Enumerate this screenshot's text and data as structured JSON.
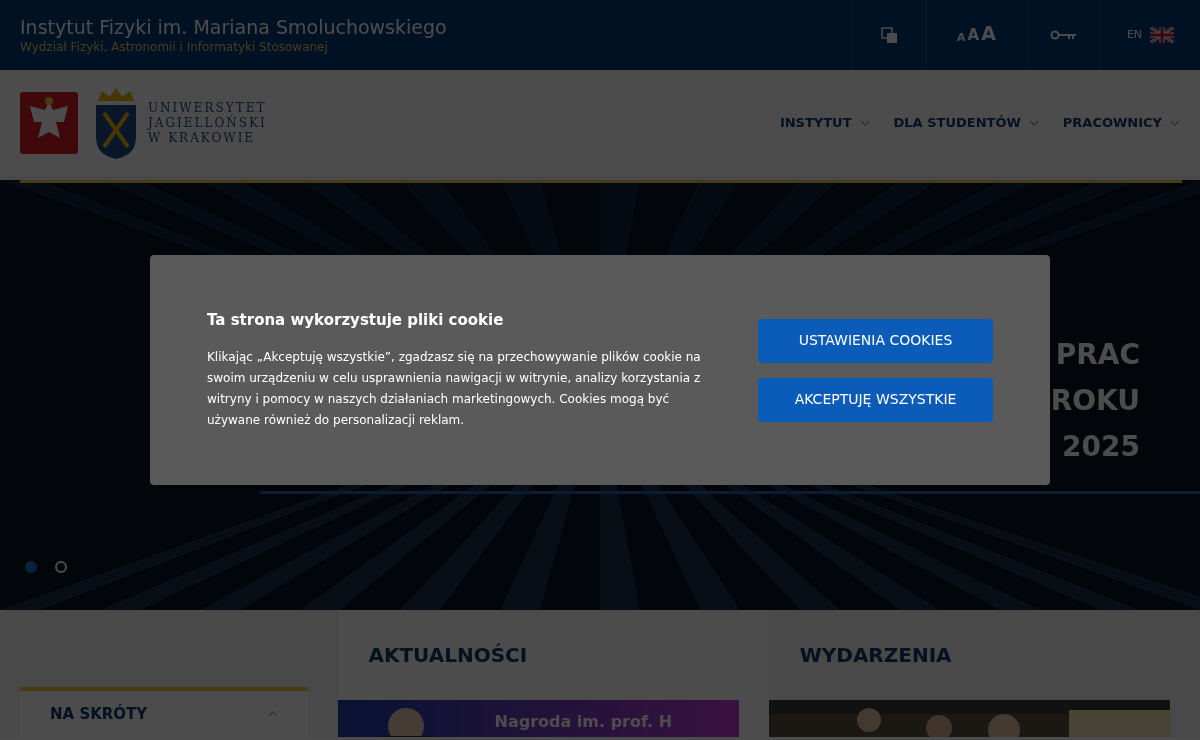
{
  "top_bar": {
    "title": "Instytut Fizyki im. Mariana Smoluchowskiego",
    "subtitle": "Wydział Fizyki, Astronomii i Informatyki Stosowanej",
    "font_sizes": [
      "A",
      "A",
      "A"
    ],
    "language": "EN"
  },
  "header": {
    "university_lines": [
      "UNIWERSYTET",
      "JAGIELLOŃSKI",
      "W KRAKOWIE"
    ],
    "nav": [
      {
        "label": "INSTYTUT",
        "expanded": false
      },
      {
        "label": "DLA STUDENTÓW",
        "expanded": false
      },
      {
        "label": "PRACOWNICY",
        "expanded": false
      }
    ]
  },
  "hero": {
    "headline_lines": [
      "PRAC",
      "ROKU",
      "2025"
    ],
    "dots": [
      {
        "selected": true
      },
      {
        "selected": false
      }
    ]
  },
  "sidebar": {
    "title": "NA SKRÓTY",
    "expanded": true
  },
  "sections": [
    {
      "title": "AKTUALNOŚCI",
      "card_text": "Nagroda im. prof. H"
    },
    {
      "title": "WYDARZENIA"
    }
  ],
  "cookie_dialog": {
    "title": "Ta strona wykorzystuje pliki cookie",
    "body": "Klikając „Akceptuję wszystkie”, zgadzasz się na przechowywanie plików cookie na swoim urządzeniu w celu usprawnienia nawigacji w witrynie, analizy korzystania z witryny i pomocy w naszych działaniach marketingowych. Cookies mogą być używane również do personalizacji reklam.",
    "buttons": [
      "USTAWIENIA COOKIES",
      "AKCEPTUJĘ WSZYSTKIE"
    ]
  }
}
